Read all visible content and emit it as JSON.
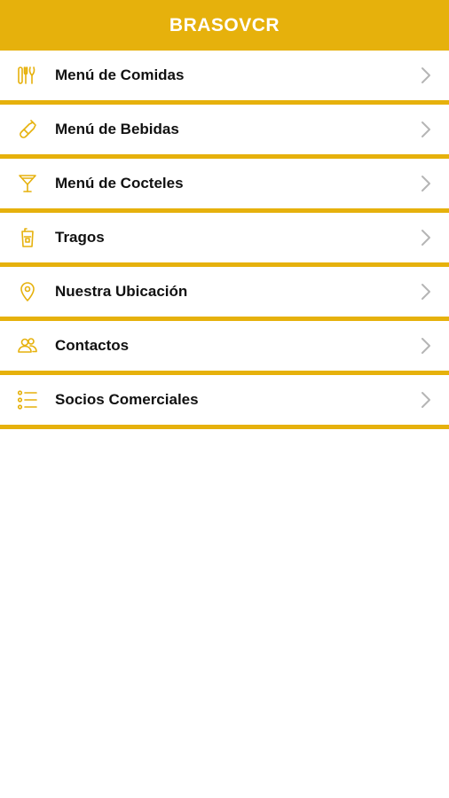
{
  "app": {
    "title": "BRASOVCR",
    "accent_color": "#e6b10c"
  },
  "menu": {
    "items": [
      {
        "label": "Menú de Comidas",
        "icon": "utensils-icon"
      },
      {
        "label": "Menú de Bebidas",
        "icon": "bottle-icon"
      },
      {
        "label": "Menú de Cocteles",
        "icon": "cocktail-icon"
      },
      {
        "label": "Tragos",
        "icon": "glass-icon"
      },
      {
        "label": "Nuestra Ubicación",
        "icon": "location-pin-icon"
      },
      {
        "label": "Contactos",
        "icon": "contacts-icon"
      },
      {
        "label": "Socios Comerciales",
        "icon": "list-icon"
      }
    ]
  }
}
